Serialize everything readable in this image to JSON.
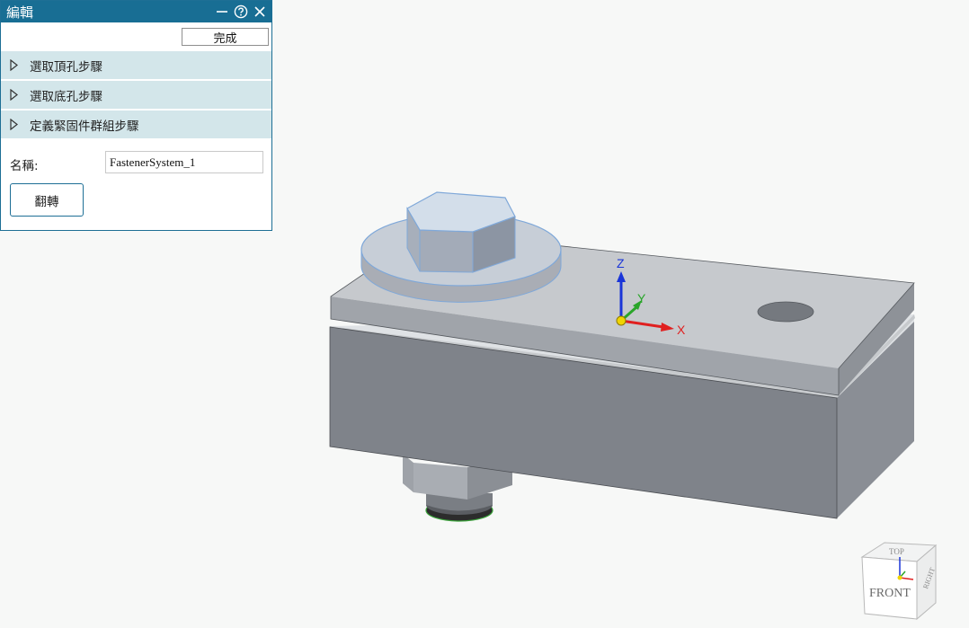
{
  "panel": {
    "title": "編輯",
    "done_label": "完成",
    "steps": [
      {
        "label": "選取頂孔步驟"
      },
      {
        "label": "選取底孔步驟"
      },
      {
        "label": "定義緊固件群組步驟"
      }
    ],
    "name_label": "名稱:",
    "name_value": "FastenerSystem_1",
    "flip_label": "翻轉"
  },
  "triad": {
    "x": "X",
    "y": "Y",
    "z": "Z"
  },
  "view_cube": {
    "front": "FRONT",
    "top": "TOP",
    "right": "RIGHT"
  },
  "colors": {
    "accent": "#186e94",
    "step_bg": "#d3e6ea",
    "x_axis": "#e02020",
    "y_axis": "#2aa52a",
    "z_axis": "#1a35d8"
  }
}
